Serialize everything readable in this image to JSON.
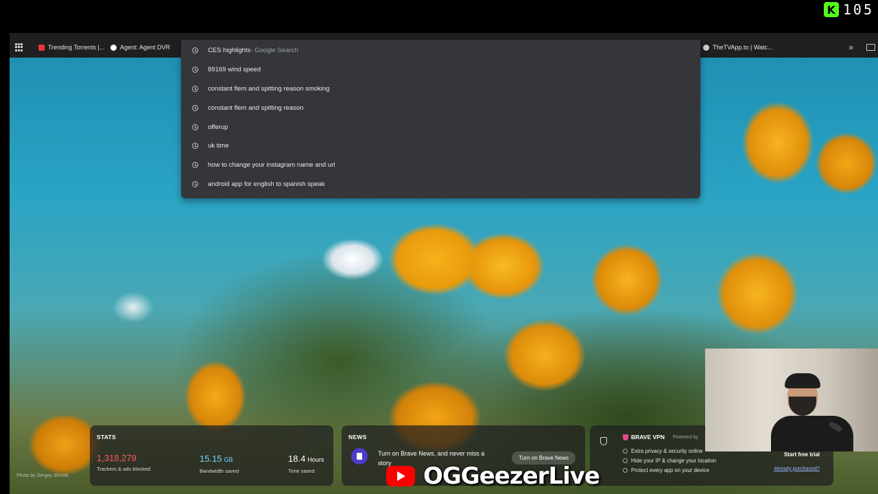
{
  "stream": {
    "viewer_count": "105",
    "platform_icon": "kick-icon"
  },
  "bookmarks": {
    "items": [
      {
        "label": "Trending Torrents |...",
        "icon": "torrent-icon",
        "color": "#e53935"
      },
      {
        "label": "Agent: Agent DVR",
        "icon": "agent-dvr-icon",
        "color": "#ffffff"
      },
      {
        "label": "TheTVApp.to | Watc...",
        "icon": "globe-icon",
        "color": "#cccccc"
      }
    ]
  },
  "omnibox": {
    "suggestions": [
      {
        "text": "CES highlights",
        "sub": " - Google Search"
      },
      {
        "text": "89169 wind speed",
        "sub": ""
      },
      {
        "text": "constant flem and spitting reason smoking",
        "sub": ""
      },
      {
        "text": "constant flem and spitting reason",
        "sub": ""
      },
      {
        "text": "offerup",
        "sub": ""
      },
      {
        "text": "uk time",
        "sub": ""
      },
      {
        "text": "how to change your instagram name and url",
        "sub": ""
      },
      {
        "text": "android app for english to spanish speak",
        "sub": ""
      }
    ]
  },
  "stats": {
    "title": "STATS",
    "trackers": {
      "value": "1,318,279",
      "label": "Trackers & ads blocked",
      "color": "#fb5b5b"
    },
    "bandwidth": {
      "value": "15.15",
      "unit": "GB",
      "label": "Bandwidth saved",
      "color": "#7bd3ff"
    },
    "time": {
      "value": "18.4",
      "unit": "Hours",
      "label": "Time saved",
      "color": "#ffffff"
    }
  },
  "news": {
    "title": "NEWS",
    "text": "Turn on Brave News, and never miss a story",
    "button": "Turn on Brave News"
  },
  "vpn": {
    "title": "BRAVE VPN",
    "powered": "Powered by",
    "features": [
      "Extra privacy & security online",
      "Hide your IP & change your location",
      "Protect every app on your device"
    ],
    "button": "Start free trial",
    "link": "Already purchased?"
  },
  "photo_credit": "Photo by Sergey Shmidt",
  "channel": {
    "name": "OGGeezerLive"
  }
}
